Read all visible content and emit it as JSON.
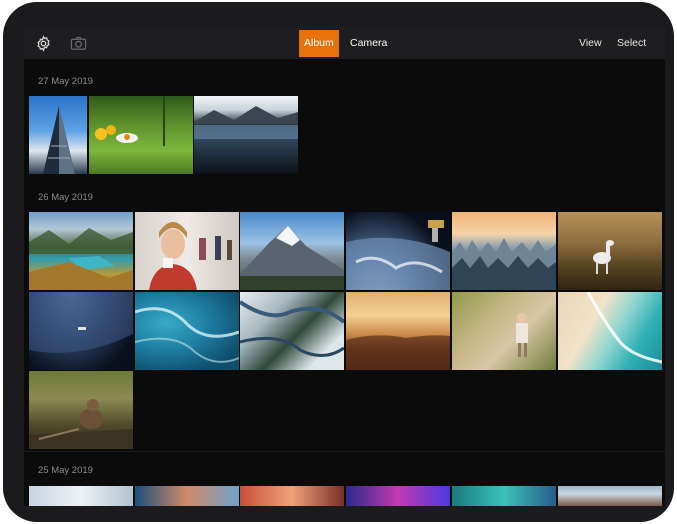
{
  "toolbar": {
    "settings_icon": "gear-icon",
    "camera_icon": "camera-icon",
    "segments": [
      "Album",
      "Camera"
    ],
    "active_segment": "Album",
    "view_label": "View",
    "select_label": "Select",
    "accent_color": "#e8710c"
  },
  "sections": [
    {
      "date": "27 May 2019",
      "photos": [
        "architecture",
        "flower-meadow",
        "mountain-lake"
      ]
    },
    {
      "date": "26 May 2019",
      "photos": [
        "fjord-valley",
        "woman-portrait",
        "snowy-peak",
        "earth-space-station",
        "frosted-forest-sunset",
        "horse-meadow",
        "earth-from-space",
        "ocean-aerial",
        "snowy-river-aerial",
        "desert-dunes",
        "forest-hiker",
        "beach-aerial",
        "wild-animal"
      ]
    },
    {
      "date": "25 May 2019",
      "photos": [
        "bridge-lines",
        "sunset-sky",
        "coral-glow",
        "neon-lights",
        "teal-water",
        "mountain-range"
      ]
    }
  ]
}
